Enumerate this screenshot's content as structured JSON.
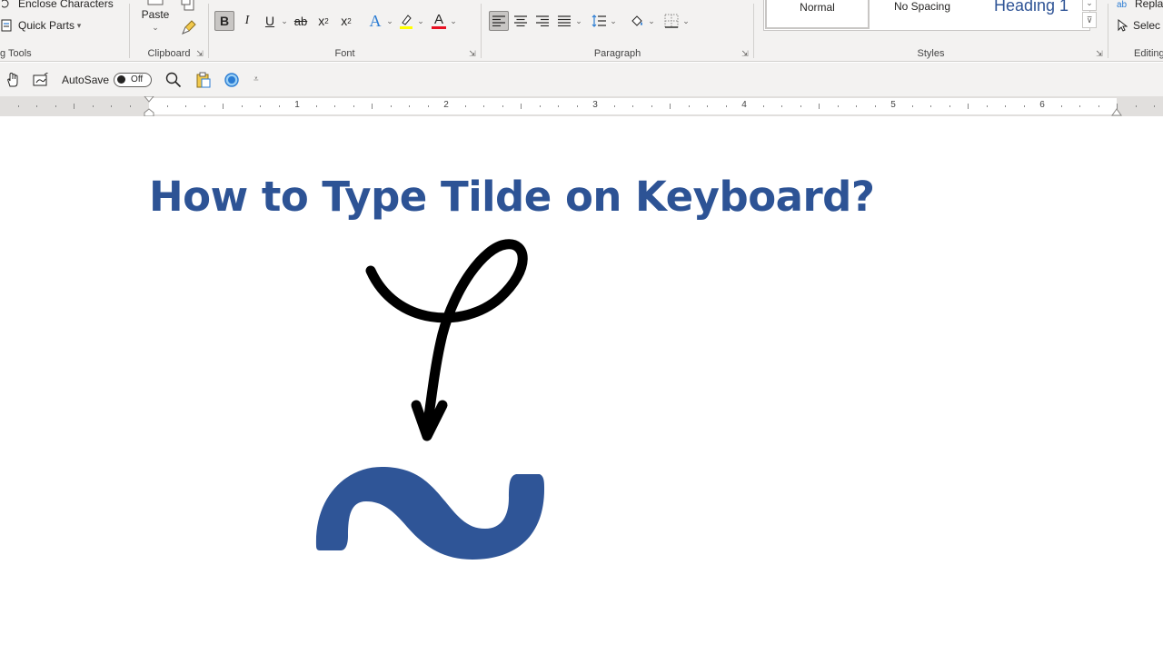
{
  "ribbon": {
    "insert_partial": {
      "enclose_characters": "Enclose Characters",
      "quick_parts": "Quick Parts",
      "label": "g Tools"
    },
    "clipboard": {
      "paste": "Paste",
      "label": "Clipboard"
    },
    "font": {
      "label": "Font",
      "bold": "B",
      "italic": "I",
      "underline": "U",
      "strikethrough": "ab",
      "subscript": "x",
      "superscript": "x",
      "subscript_mark": "2",
      "superscript_mark": "2",
      "text_effects": "A",
      "font_color": "A",
      "font_color_hex": "#e81123",
      "highlight_hex": "#ffff00"
    },
    "paragraph": {
      "label": "Paragraph"
    },
    "styles": {
      "label": "Styles",
      "items": [
        "Normal",
        "No Spacing",
        "Heading 1"
      ]
    },
    "editing": {
      "label": "Editing",
      "replace": "Repla",
      "select": "Selec"
    }
  },
  "qat": {
    "autosave_label": "AutoSave",
    "autosave_state": "Off"
  },
  "ruler": {
    "numbers": [
      "1",
      "2",
      "3",
      "4",
      "5",
      "6"
    ]
  },
  "document": {
    "title": "How to Type Tilde on Keyboard?",
    "title_color": "#2d5395",
    "tilde_color": "#2f5597",
    "arrow_color": "#000000"
  }
}
